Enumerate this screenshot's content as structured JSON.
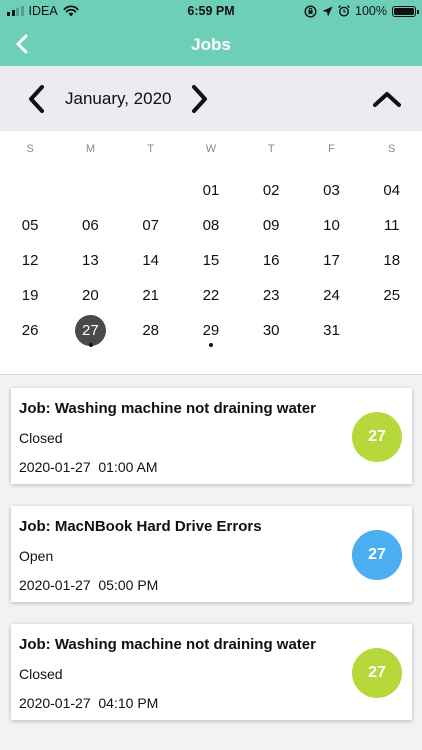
{
  "status_bar": {
    "carrier": "IDEA",
    "time": "6:59 PM",
    "battery": "100%"
  },
  "nav": {
    "title": "Jobs",
    "back_icon": "chevron-left-icon"
  },
  "calendar": {
    "month_label": "January, 2020",
    "weekdays": [
      "S",
      "M",
      "T",
      "W",
      "T",
      "F",
      "S"
    ],
    "weeks": [
      [
        "",
        "",
        "",
        "01",
        "02",
        "03",
        "04"
      ],
      [
        "05",
        "06",
        "07",
        "08",
        "09",
        "10",
        "11"
      ],
      [
        "12",
        "13",
        "14",
        "15",
        "16",
        "17",
        "18"
      ],
      [
        "19",
        "20",
        "21",
        "22",
        "23",
        "24",
        "25"
      ],
      [
        "26",
        "27",
        "28",
        "29",
        "30",
        "31",
        ""
      ]
    ],
    "selected_day": "27",
    "days_with_events": [
      "27",
      "29"
    ]
  },
  "jobs": [
    {
      "title": "Job: Washing machine not draining water",
      "status": "Closed",
      "datetime": "2020-01-27  01:00 AM",
      "badge": "27",
      "badge_color": "#b7d83a"
    },
    {
      "title": "Job: MacNBook Hard Drive Errors",
      "status": "Open",
      "datetime": "2020-01-27  05:00 PM",
      "badge": "27",
      "badge_color": "#4baef0"
    },
    {
      "title": "Job: Washing machine not draining water",
      "status": "Closed",
      "datetime": "2020-01-27  04:10 PM",
      "badge": "27",
      "badge_color": "#b7d83a"
    }
  ]
}
